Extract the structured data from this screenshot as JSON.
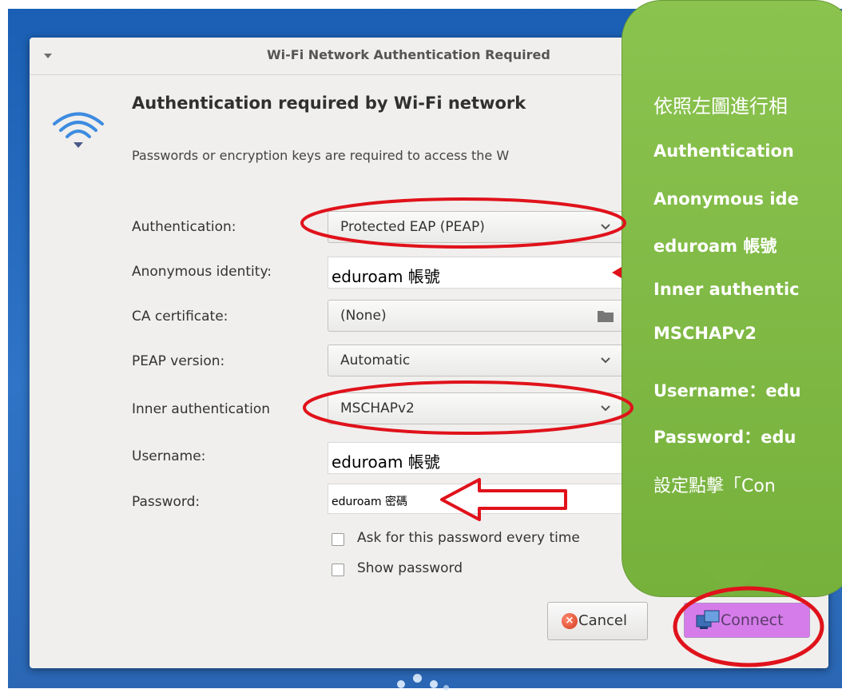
{
  "dialog": {
    "title": "Wi-Fi Network Authentication Required",
    "heading": "Authentication required by Wi-Fi network",
    "description": "Passwords or encryption keys are required to access the W"
  },
  "form": {
    "authentication": {
      "label": "Authentication:",
      "value": "Protected EAP (PEAP)"
    },
    "anonymous_identity": {
      "label": "Anonymous identity:",
      "value": "eduroam  帳號"
    },
    "ca_certificate": {
      "label": "CA certificate:",
      "value": "(None)"
    },
    "peap_version": {
      "label": "PEAP version:",
      "value": "Automatic"
    },
    "inner_authentication": {
      "label": "Inner authentication",
      "value": "MSCHAPv2"
    },
    "username": {
      "label": "Username:",
      "value": "eduroam  帳號"
    },
    "password": {
      "label": "Password:",
      "value": "eduroam  密碼"
    },
    "ask_password": {
      "label": "Ask for this password every time",
      "checked": false
    },
    "show_password": {
      "label": "Show password",
      "checked": false
    }
  },
  "buttons": {
    "cancel": "Cancel",
    "connect": "Connect"
  },
  "callout": {
    "line1": "依照左圖進行相",
    "line2": "Authentication",
    "line3": "Anonymous ide",
    "line4": "eduroam 帳號",
    "line5": "Inner authentic",
    "line6": "MSCHAPv2",
    "line7": "Username：edu",
    "line8": "Password：edu",
    "line9": "設定點擊「Con"
  },
  "colors": {
    "desktop_blue": "#2f74c6",
    "callout_green": "#7cb843",
    "annotation_red": "#e0121b",
    "connect_highlight": "#d67cea"
  },
  "icons": [
    "menu-arrow-icon",
    "wifi-icon",
    "chevron-down-icon",
    "folder-icon",
    "cancel-icon",
    "network-connect-icon"
  ]
}
